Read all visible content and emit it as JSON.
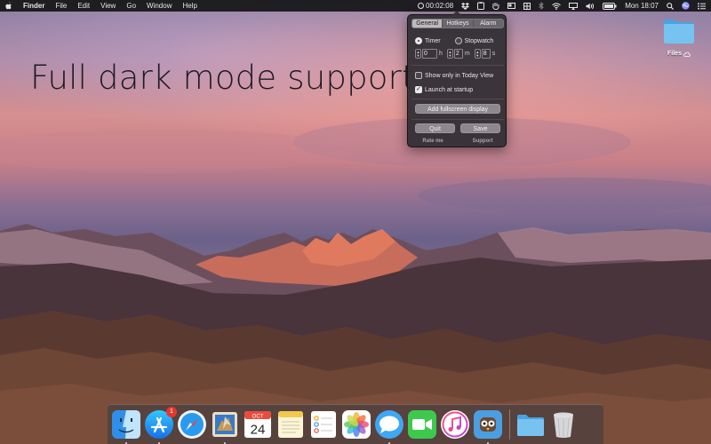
{
  "menubar": {
    "app_name": "Finder",
    "menus": [
      "File",
      "Edit",
      "View",
      "Go",
      "Window",
      "Help"
    ],
    "timer_display": "00:02:08",
    "clock": "Mon 18:07"
  },
  "headline": "Full dark mode support",
  "desktop": {
    "icon_label": "Files"
  },
  "popover": {
    "tabs": [
      "General",
      "Hotkeys",
      "Alarm"
    ],
    "active_tab": "General",
    "mode_timer": "Timer",
    "mode_stopwatch": "Stopwatch",
    "selected_mode": "Timer",
    "hours_value": "0",
    "hours_unit": "h",
    "minutes_value": "2",
    "minutes_unit": "m",
    "seconds_value": "8",
    "seconds_unit": "s",
    "option_today_view": "Show only in Today View",
    "option_today_view_checked": false,
    "option_launch": "Launch at startup",
    "option_launch_checked": true,
    "fullscreen_button": "Add fullscreen display",
    "quit_button": "Quit",
    "save_button": "Save",
    "rate_link": "Rate me",
    "support_link": "Support"
  },
  "dock": {
    "app_store_badge": "1",
    "calendar_month": "OCT",
    "calendar_day": "24",
    "items": [
      "finder-icon",
      "app-store-icon",
      "safari-icon",
      "mail-icon",
      "calendar-icon",
      "notes-icon",
      "reminders-icon",
      "photos-icon",
      "messages-icon",
      "facetime-icon",
      "itunes-icon",
      "tweetbot-icon",
      "downloads-folder-icon",
      "trash-icon"
    ]
  },
  "colors": {
    "menubar_bg": "#161618",
    "popover_bg": "#343036",
    "badge_red": "#e3382f",
    "folder_blue": "#5ab4ec"
  }
}
